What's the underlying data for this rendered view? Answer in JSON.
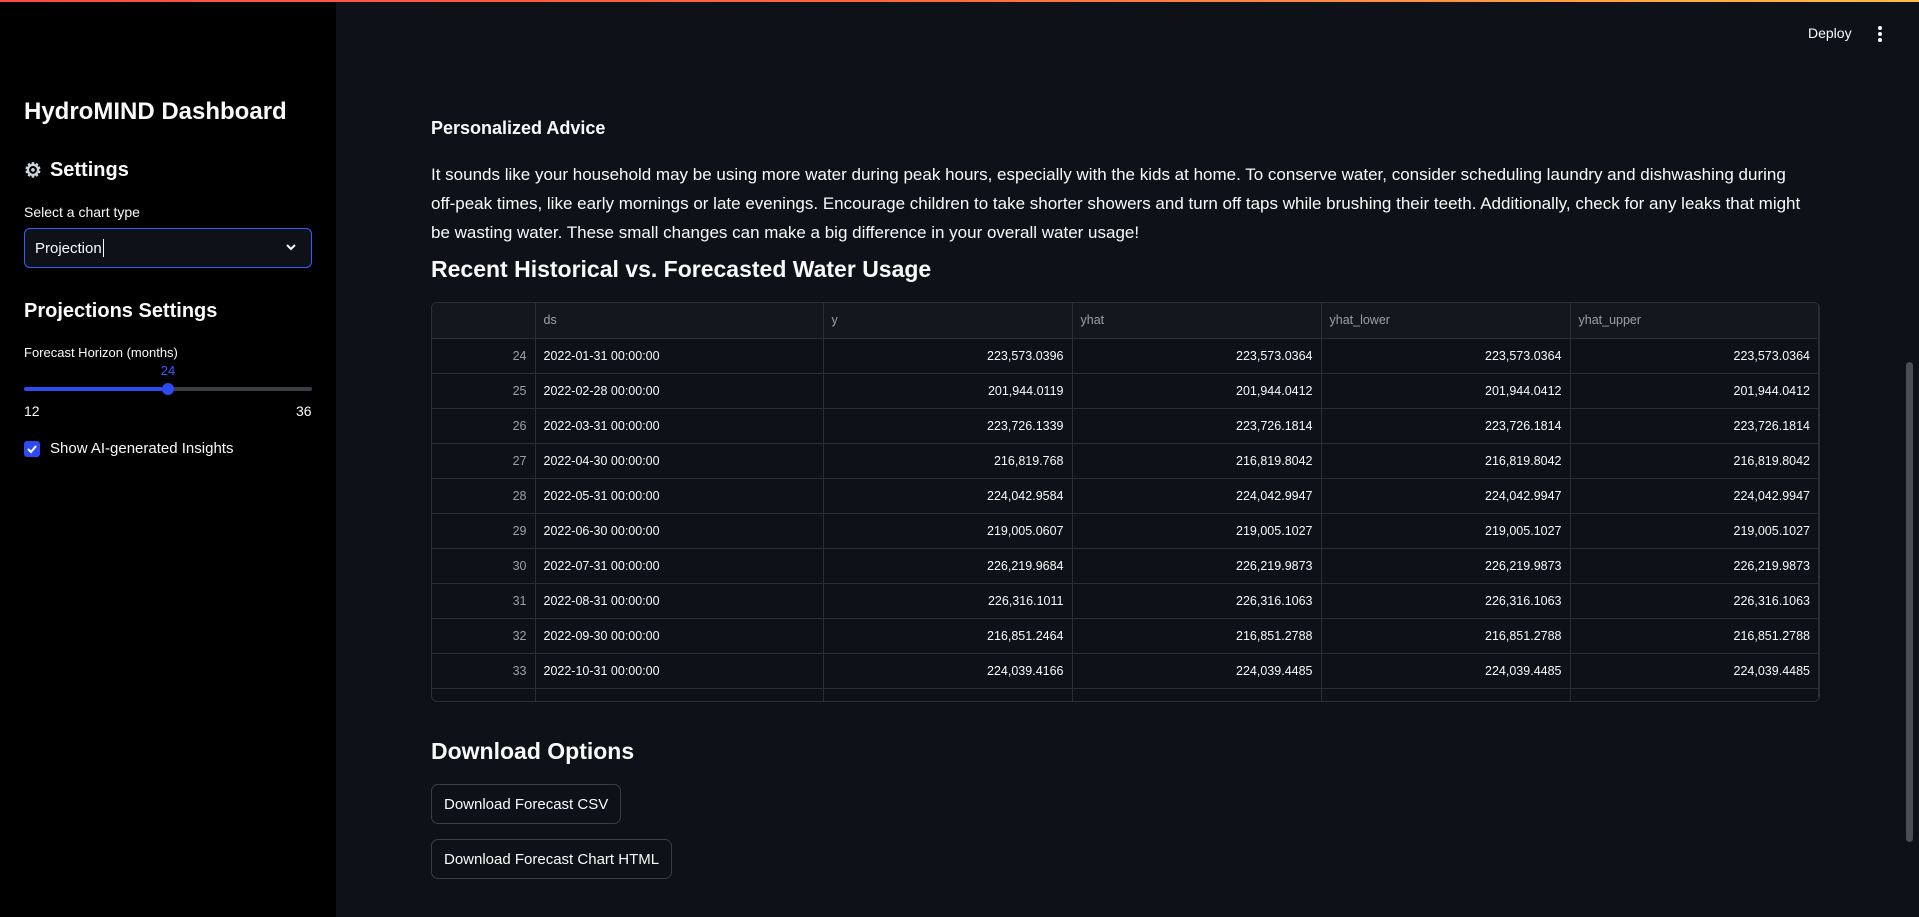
{
  "header": {
    "deploy_label": "Deploy"
  },
  "sidebar": {
    "title": "HydroMIND Dashboard",
    "settings_heading": "Settings",
    "chart_type_label": "Select a chart type",
    "chart_type_value": "Projection",
    "projections_heading": "Projections Settings",
    "forecast_label": "Forecast Horizon (months)",
    "slider": {
      "value": "24",
      "min": "12",
      "max": "36",
      "fraction": 0.5
    },
    "insights_label": "Show AI-generated Insights",
    "insights_checked": true,
    "accent_color": "#2d4bf0"
  },
  "main": {
    "advice_title": "Personalized Advice",
    "advice_text": "It sounds like your household may be using more water during peak hours, especially with the kids at home. To conserve water, consider scheduling laundry and dishwashing during off-peak times, like early mornings or late evenings. Encourage children to take shorter showers and turn off taps while brushing their teeth. Additionally, check for any leaks that might be wasting water. These small changes can make a big difference in your overall water usage!",
    "table_title": "Recent Historical vs. Forecasted Water Usage",
    "table": {
      "columns": [
        "",
        "ds",
        "y",
        "yhat",
        "yhat_lower",
        "yhat_upper"
      ],
      "rows": [
        [
          "24",
          "2022-01-31 00:00:00",
          "223,573.0396",
          "223,573.0364",
          "223,573.0364",
          "223,573.0364"
        ],
        [
          "25",
          "2022-02-28 00:00:00",
          "201,944.0119",
          "201,944.0412",
          "201,944.0412",
          "201,944.0412"
        ],
        [
          "26",
          "2022-03-31 00:00:00",
          "223,726.1339",
          "223,726.1814",
          "223,726.1814",
          "223,726.1814"
        ],
        [
          "27",
          "2022-04-30 00:00:00",
          "216,819.768",
          "216,819.8042",
          "216,819.8042",
          "216,819.8042"
        ],
        [
          "28",
          "2022-05-31 00:00:00",
          "224,042.9584",
          "224,042.9947",
          "224,042.9947",
          "224,042.9947"
        ],
        [
          "29",
          "2022-06-30 00:00:00",
          "219,005.0607",
          "219,005.1027",
          "219,005.1027",
          "219,005.1027"
        ],
        [
          "30",
          "2022-07-31 00:00:00",
          "226,219.9684",
          "226,219.9873",
          "226,219.9873",
          "226,219.9873"
        ],
        [
          "31",
          "2022-08-31 00:00:00",
          "226,316.1011",
          "226,316.1063",
          "226,316.1063",
          "226,316.1063"
        ],
        [
          "32",
          "2022-09-30 00:00:00",
          "216,851.2464",
          "216,851.2788",
          "216,851.2788",
          "216,851.2788"
        ],
        [
          "33",
          "2022-10-31 00:00:00",
          "224,039.4166",
          "224,039.4485",
          "224,039.4485",
          "224,039.4485"
        ]
      ]
    },
    "download_title": "Download Options",
    "download_csv_label": "Download Forecast CSV",
    "download_html_label": "Download Forecast Chart HTML"
  }
}
